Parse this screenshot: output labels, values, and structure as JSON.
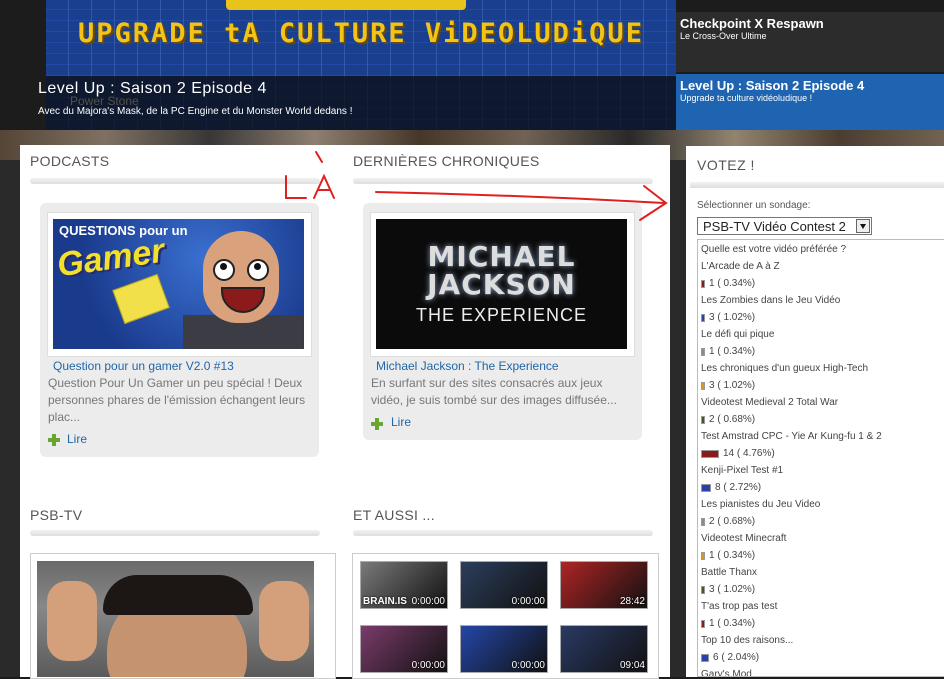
{
  "slider": {
    "banner_text": "UPGRADE tA CULTURE ViDEOLUDiQUE",
    "caption_title": "Level Up : Saison 2 Episode 4",
    "caption_desc": "Avec du Majora's Mask, de la PC Engine et du Monster World dedans !",
    "ghost_text": "Power Stone",
    "items": [
      {
        "title": "Checkpoint X Respawn",
        "subtitle": "Le Cross-Over Ultime"
      },
      {
        "title": "Level Up : Saison 2 Episode 4",
        "subtitle": "Upgrade ta culture vidéoludique !"
      }
    ]
  },
  "sections": {
    "podcasts": "PODCASTS",
    "chroniques": "DERNIÈRES CHRONIQUES",
    "psbtv": "PSB-TV",
    "etaussi": "ET AUSSI ..."
  },
  "podcast": {
    "art_top": "QUESTIONS pour un",
    "art_main": "Gamer",
    "title": "Question pour un gamer V2.0 #13",
    "text": "Question Pour Un Gamer un peu spécial ! Deux personnes phares de l'émission échangent leurs plac...",
    "read": "Lire"
  },
  "chronique": {
    "art_line1": "MICHAEL JACKSON",
    "art_line2": "THE EXPERIENCE",
    "title": "Michael Jackson : The Experience",
    "text": "En surfant sur des sites consacrés aux jeux vidéo, je suis tombé sur des images diffusée...",
    "read": "Lire"
  },
  "thumbs": [
    {
      "duration": "0:00:00",
      "label": "BRAIN.IS",
      "color": "#7a7a7a"
    },
    {
      "duration": "0:00:00",
      "color": "#2c3e5c"
    },
    {
      "duration": "28:42",
      "color": "#b02424"
    },
    {
      "duration": "0:00:00",
      "color": "#7b3b6b"
    },
    {
      "duration": "0:00:00",
      "color": "#2446a8"
    },
    {
      "duration": "09:04",
      "color": "#2a3a64"
    }
  ],
  "annotation": {
    "text": "LÀ",
    "color": "#e02020"
  },
  "vote": {
    "title": "VOTEZ !",
    "select_label": "Sélectionner un sondage:",
    "selected_poll": "PSB-TV Vidéo Contest 2",
    "question": "Quelle est votre vidéo préférée ?",
    "options": [
      {
        "name": "L'Arcade de A à Z",
        "votes": "1 ( 0.34%)",
        "count": 1,
        "color": "#8b1a1a"
      },
      {
        "name": "Les Zombies dans le Jeu Vidéo",
        "votes": "3 ( 1.02%)",
        "count": 3,
        "color": "#2b3fae"
      },
      {
        "name": "Le défi qui pique",
        "votes": "1 ( 0.34%)",
        "count": 1,
        "color": "#8a8a8a"
      },
      {
        "name": "Les chroniques d'un gueux High-Tech",
        "votes": "3 ( 1.02%)",
        "count": 3,
        "color": "#d99a1a"
      },
      {
        "name": "Videotest Medieval 2 Total War",
        "votes": "2 ( 0.68%)",
        "count": 2,
        "color": "#3f5a1e"
      },
      {
        "name": "Test Amstrad CPC - Yie Ar Kung-fu 1 & 2",
        "votes": "14 ( 4.76%)",
        "count": 14,
        "color": "#8b1a1a"
      },
      {
        "name": "Kenji-Pixel Test #1",
        "votes": "8 ( 2.72%)",
        "count": 8,
        "color": "#2b3fae"
      },
      {
        "name": "Les pianistes du Jeu Video",
        "votes": "2 ( 0.68%)",
        "count": 2,
        "color": "#8a8a8a"
      },
      {
        "name": "Videotest Minecraft",
        "votes": "1 ( 0.34%)",
        "count": 1,
        "color": "#d99a1a"
      },
      {
        "name": "Battle Thanx",
        "votes": "3 ( 1.02%)",
        "count": 3,
        "color": "#3f5a1e"
      },
      {
        "name": "T'as trop pas test",
        "votes": "1 ( 0.34%)",
        "count": 1,
        "color": "#8b1a1a"
      },
      {
        "name": "Top 10 des raisons...",
        "votes": "6 ( 2.04%)",
        "count": 6,
        "color": "#2b3fae"
      },
      {
        "name": "Gary's Mod",
        "votes": "",
        "count": 0,
        "color": "#8a8a8a"
      }
    ]
  }
}
